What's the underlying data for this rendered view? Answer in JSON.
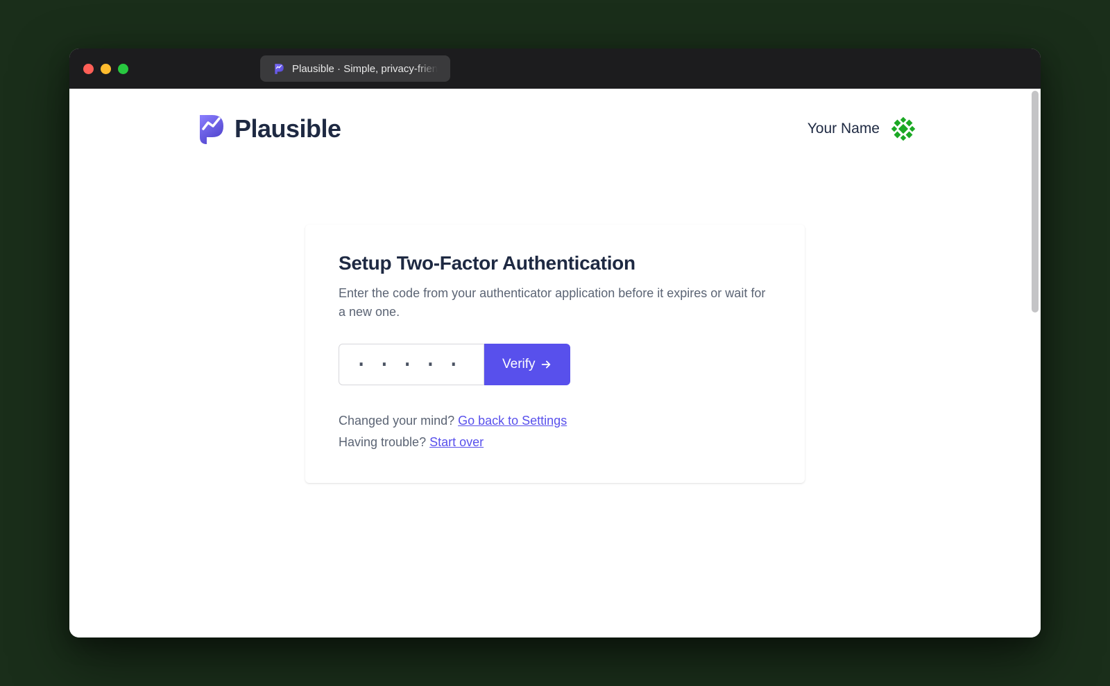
{
  "browser": {
    "tab_title": "Plausible · Simple, privacy-frien"
  },
  "header": {
    "brand_name": "Plausible",
    "user_name": "Your Name"
  },
  "card": {
    "title": "Setup Two-Factor Authentication",
    "subtitle": "Enter the code from your authenticator application before it expires or wait for a new one.",
    "code_placeholder": "······",
    "verify_label": "Verify",
    "help_line1_prefix": "Changed your mind? ",
    "help_line1_link": "Go back to Settings",
    "help_line2_prefix": "Having trouble? ",
    "help_line2_link": "Start over"
  }
}
